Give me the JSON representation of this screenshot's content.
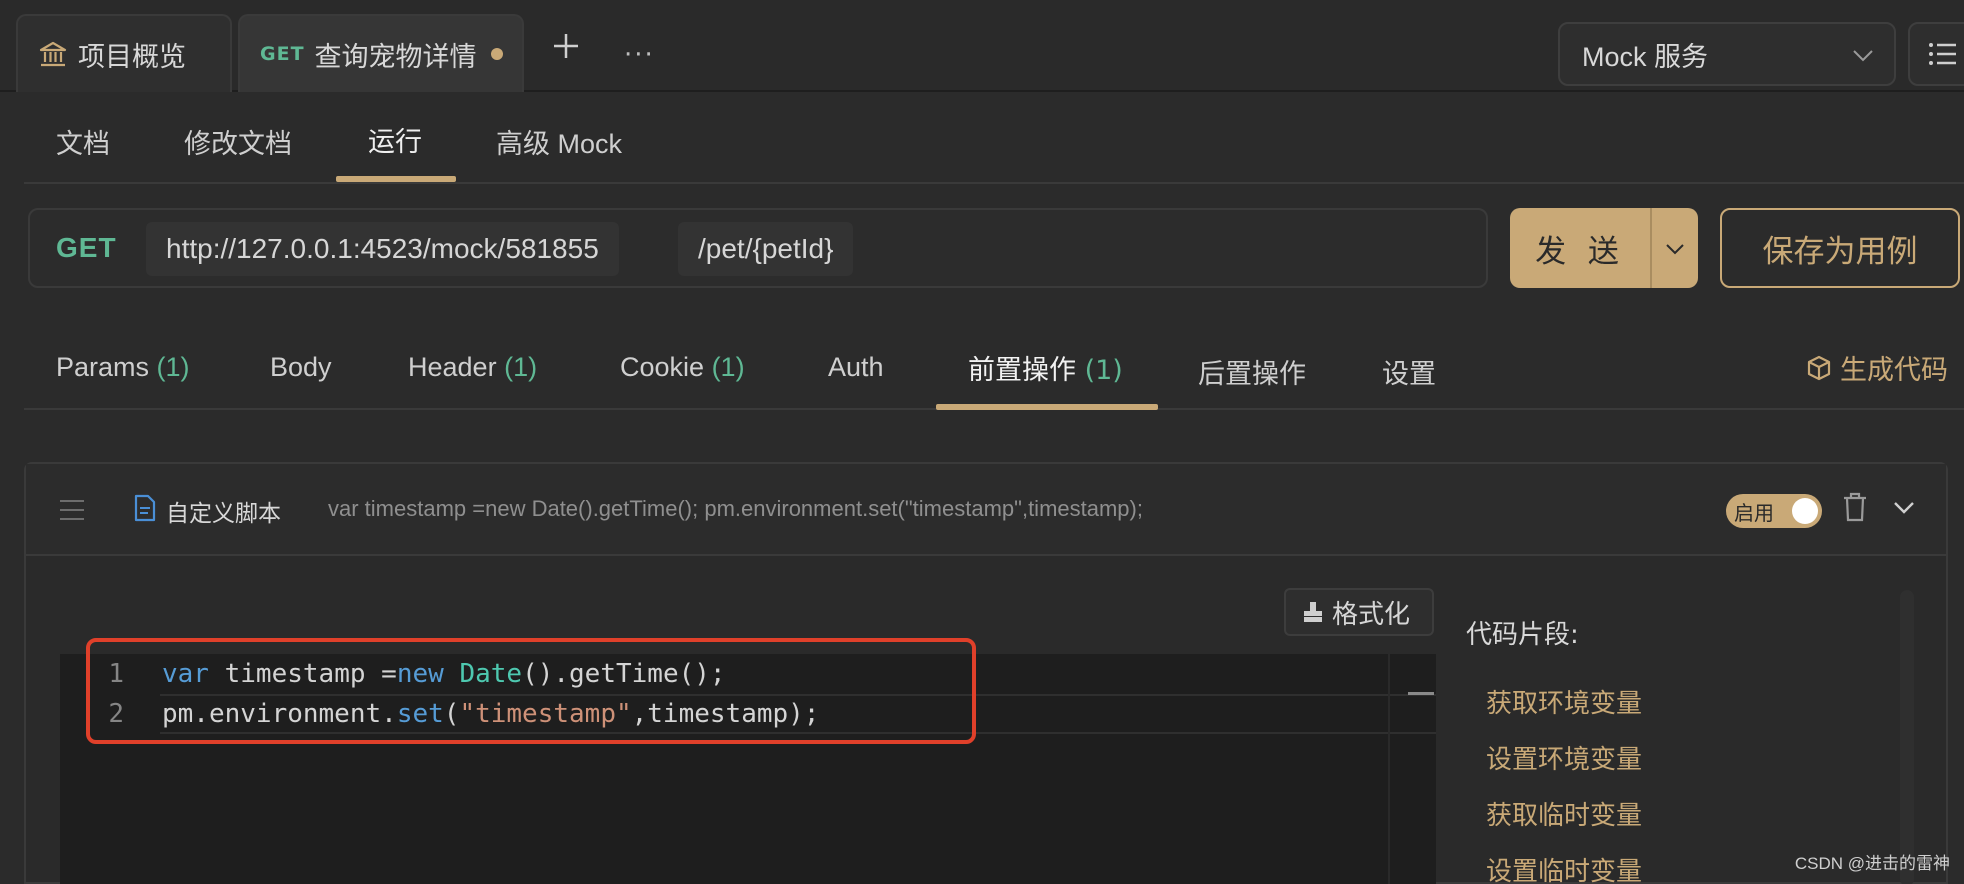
{
  "tabs": {
    "overview_label": "项目概览",
    "active_method": "GET",
    "active_label": "查询宠物详情",
    "more_label": "···"
  },
  "env_select": {
    "value": "Mock 服务"
  },
  "subtabs": [
    "文档",
    "修改文档",
    "运行",
    "高级 Mock"
  ],
  "request": {
    "method": "GET",
    "base_url": "http://127.0.0.1:4523/mock/581855",
    "path": "/pet/{petId}",
    "send_label": "发 送",
    "save_label": "保存为用例"
  },
  "req_tabs": [
    {
      "label": "Params",
      "count": "(1)"
    },
    {
      "label": "Body",
      "count": ""
    },
    {
      "label": "Header",
      "count": "(1)"
    },
    {
      "label": "Cookie",
      "count": "(1)"
    },
    {
      "label": "Auth",
      "count": ""
    },
    {
      "label": "前置操作",
      "count": "(1)"
    },
    {
      "label": "后置操作",
      "count": ""
    },
    {
      "label": "设置",
      "count": ""
    }
  ],
  "gencode_label": "生成代码",
  "script": {
    "title": "自定义脚本",
    "preview": "var timestamp =new Date().getTime(); pm.environment.set(\"timestamp\",timestamp);",
    "toggle_label": "启用",
    "format_label": "格式化",
    "line_numbers": [
      "1",
      "2"
    ],
    "line1": {
      "kw": "var",
      "a": " timestamp =",
      "kw2": "new",
      "sp": " ",
      "cls": "Date",
      "b": "().getTime();"
    },
    "line2": {
      "a": "pm.environment.",
      "fn": "set",
      "b": "(",
      "str": "\"timestamp\"",
      "c": ",timestamp);"
    }
  },
  "snippets": {
    "title": "代码片段:",
    "items": [
      "获取环境变量",
      "设置环境变量",
      "获取临时变量",
      "设置临时变量"
    ]
  },
  "watermark": "CSDN @进击的雷神",
  "colors": {
    "accent": "#c9a977",
    "method_green": "#5fb894",
    "highlight": "#e0402a"
  }
}
